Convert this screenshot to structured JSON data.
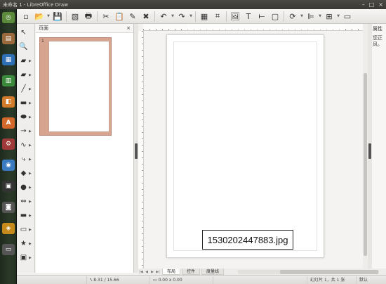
{
  "window": {
    "title": "未命名 1 - LibreOffice Draw"
  },
  "launcher": {
    "items": [
      {
        "icon": "dash-icon",
        "glyph": "◎",
        "color": "#5a8a3a"
      },
      {
        "icon": "files-icon",
        "glyph": "▤",
        "color": "#9b6a3c"
      },
      {
        "icon": "writer-icon",
        "glyph": "▦",
        "color": "#2f6fb3"
      },
      {
        "icon": "calc-icon",
        "glyph": "▥",
        "color": "#3b8a3b"
      },
      {
        "icon": "impress-icon",
        "glyph": "◧",
        "color": "#d27b2a"
      },
      {
        "icon": "software-center-icon",
        "glyph": "A",
        "color": "#d2692a"
      },
      {
        "icon": "settings-icon",
        "glyph": "⚙",
        "color": "#a03a3a"
      },
      {
        "icon": "browser-icon",
        "glyph": "◉",
        "color": "#3a7ac0"
      },
      {
        "icon": "terminal-icon",
        "glyph": "▣",
        "color": "#333333"
      },
      {
        "icon": "camera-icon",
        "glyph": "◙",
        "color": "#555555"
      },
      {
        "icon": "draw-icon",
        "glyph": "◈",
        "color": "#c68a1a"
      },
      {
        "icon": "trash-icon",
        "glyph": "▭",
        "color": "#555555"
      }
    ]
  },
  "toolbar": {
    "icons": [
      "new-icon",
      "open-icon",
      "save-icon",
      "export-pdf-icon",
      "print-icon",
      "cut-icon",
      "paste-icon",
      "clone-icon",
      "clear-icon",
      "undo-icon",
      "redo-icon",
      "grid-icon",
      "helplines-icon",
      "image-icon",
      "text-icon",
      "fontwork-icon",
      "textbox-icon",
      "rotate-icon",
      "align-icon",
      "arrange-icon",
      "sidebar-icon"
    ],
    "glyphs": [
      "▫",
      "📂",
      "💾",
      "▧",
      "🖶",
      "✂",
      "📋",
      "✎",
      "✖",
      "↶",
      "↷",
      "▦",
      "⌗",
      "🖼",
      "T",
      "⟝",
      "▢",
      "⟳",
      "⊫",
      "⊞",
      "▭"
    ]
  },
  "drawing_tools": [
    {
      "icon": "select-icon",
      "glyph": "↖"
    },
    {
      "icon": "zoom-icon",
      "glyph": "🔍"
    },
    {
      "icon": "line-color-icon",
      "glyph": "▰"
    },
    {
      "icon": "fill-color-icon",
      "glyph": "▰"
    },
    {
      "icon": "line-icon",
      "glyph": "╱"
    },
    {
      "icon": "rectangle-icon",
      "glyph": "▬"
    },
    {
      "icon": "ellipse-icon",
      "glyph": "⬬"
    },
    {
      "icon": "arrow-line-icon",
      "glyph": "→"
    },
    {
      "icon": "curve-icon",
      "glyph": "∿"
    },
    {
      "icon": "connector-icon",
      "glyph": "⤷"
    },
    {
      "icon": "basic-shapes-icon",
      "glyph": "◆"
    },
    {
      "icon": "symbol-shapes-icon",
      "glyph": "●"
    },
    {
      "icon": "block-arrows-icon",
      "glyph": "⇔"
    },
    {
      "icon": "flowchart-icon",
      "glyph": "▬"
    },
    {
      "icon": "callouts-icon",
      "glyph": "▭"
    },
    {
      "icon": "stars-icon",
      "glyph": "★"
    },
    {
      "icon": "3d-objects-icon",
      "glyph": "▣"
    }
  ],
  "pages_pane": {
    "title": "页面",
    "close": "×",
    "page_number": "1"
  },
  "canvas": {
    "caption": "1530202447883.jpg"
  },
  "sidebar": {
    "title": "属性",
    "body": "您正风。"
  },
  "tabs": [
    {
      "label": "布局",
      "active": true
    },
    {
      "label": "控件",
      "active": false
    },
    {
      "label": "度量线",
      "active": false
    }
  ],
  "statusbar": {
    "position": "8.31 / 15.66",
    "size": "0.00 x 0.00",
    "slide": "幻灯片 1，共 1 张",
    "mode": "默认"
  }
}
